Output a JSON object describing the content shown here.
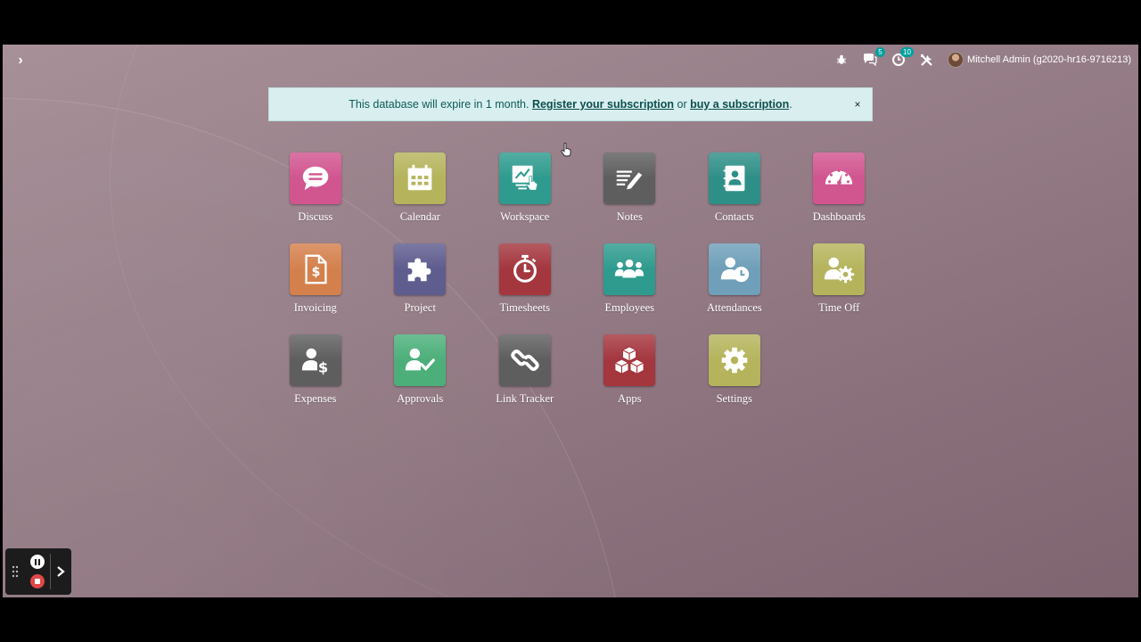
{
  "navbar": {
    "menu_toggle_glyph": "›",
    "messages_count": "5",
    "activities_count": "10",
    "user_name": "Mitchell Admin (g2020-hr16-9716213)"
  },
  "alert": {
    "text_before": "This database will expire in 1 month. ",
    "register_link": "Register your subscription",
    "text_middle": " or ",
    "buy_link": "buy a subscription",
    "text_after": ".",
    "close_glyph": "×"
  },
  "apps": [
    {
      "label": "Discuss",
      "icon": "chat-bubble-icon",
      "color": "#d1558f"
    },
    {
      "label": "Calendar",
      "icon": "calendar-icon",
      "color": "#b5b45c"
    },
    {
      "label": "Workspace",
      "icon": "workspace-board-icon",
      "color": "#2e9b8e"
    },
    {
      "label": "Notes",
      "icon": "notes-pencil-icon",
      "color": "#5e5e5e"
    },
    {
      "label": "Contacts",
      "icon": "address-book-icon",
      "color": "#2e8f87"
    },
    {
      "label": "Dashboards",
      "icon": "gauge-icon",
      "color": "#d1558f"
    },
    {
      "label": "Invoicing",
      "icon": "invoice-dollar-icon",
      "color": "#d4804c"
    },
    {
      "label": "Project",
      "icon": "puzzle-icon",
      "color": "#5f5c8e"
    },
    {
      "label": "Timesheets",
      "icon": "stopwatch-icon",
      "color": "#a4363e"
    },
    {
      "label": "Employees",
      "icon": "people-group-icon",
      "color": "#2e9b8e"
    },
    {
      "label": "Attendances",
      "icon": "user-clock-icon",
      "color": "#6f9fb9"
    },
    {
      "label": "Time Off",
      "icon": "user-gear-icon",
      "color": "#b5b45c"
    },
    {
      "label": "Expenses",
      "icon": "user-dollar-icon",
      "color": "#5e5e5e"
    },
    {
      "label": "Approvals",
      "icon": "user-check-icon",
      "color": "#4caf7a"
    },
    {
      "label": "Link Tracker",
      "icon": "link-chain-icon",
      "color": "#5e5e5e"
    },
    {
      "label": "Apps",
      "icon": "cubes-icon",
      "color": "#a4363e"
    },
    {
      "label": "Settings",
      "icon": "gear-icon",
      "color": "#b5b45c"
    }
  ],
  "colors": {
    "alert_bg": "#d9eeee",
    "badge": "#00a09d",
    "background": "#98808a"
  }
}
